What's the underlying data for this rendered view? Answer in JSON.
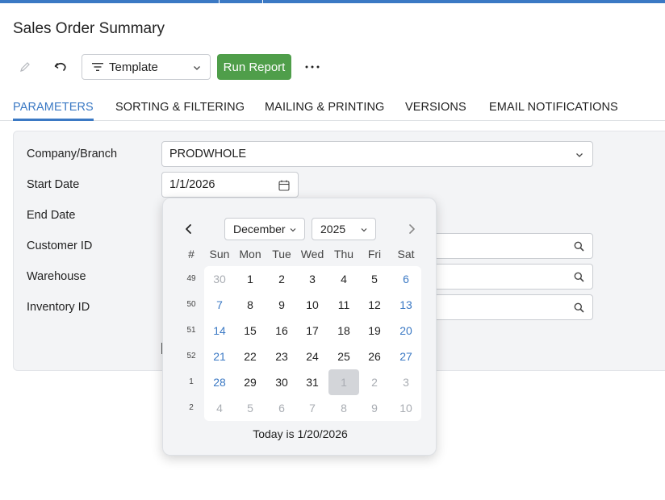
{
  "page": {
    "title": "Sales Order Summary"
  },
  "toolbar": {
    "template_label": "Template",
    "run_report_label": "Run Report",
    "more_label": "⋯"
  },
  "tabs": [
    {
      "label": "PARAMETERS",
      "active": true
    },
    {
      "label": "SORTING & FILTERING",
      "active": false
    },
    {
      "label": "MAILING & PRINTING",
      "active": false
    },
    {
      "label": "VERSIONS",
      "active": false
    },
    {
      "label": "EMAIL NOTIFICATIONS",
      "active": false
    }
  ],
  "params": {
    "company_label": "Company/Branch",
    "company_value": "PRODWHOLE",
    "start_date_label": "Start Date",
    "start_date_value": "1/1/2026",
    "end_date_label": "End Date",
    "customer_label": "Customer ID",
    "warehouse_label": "Warehouse",
    "inventory_label": "Inventory ID"
  },
  "calendar": {
    "month": "December",
    "year": "2025",
    "week_header": "#",
    "weekdays": [
      "Sun",
      "Mon",
      "Tue",
      "Wed",
      "Thu",
      "Fri",
      "Sat"
    ],
    "weeks": [
      {
        "num": "49",
        "days": [
          {
            "d": "30",
            "state": "other"
          },
          {
            "d": "1",
            "state": "normal"
          },
          {
            "d": "2",
            "state": "normal"
          },
          {
            "d": "3",
            "state": "normal"
          },
          {
            "d": "4",
            "state": "normal"
          },
          {
            "d": "5",
            "state": "normal"
          },
          {
            "d": "6",
            "state": "weekend"
          }
        ]
      },
      {
        "num": "50",
        "days": [
          {
            "d": "7",
            "state": "weekend"
          },
          {
            "d": "8",
            "state": "normal"
          },
          {
            "d": "9",
            "state": "normal"
          },
          {
            "d": "10",
            "state": "normal"
          },
          {
            "d": "11",
            "state": "normal"
          },
          {
            "d": "12",
            "state": "normal"
          },
          {
            "d": "13",
            "state": "weekend"
          }
        ]
      },
      {
        "num": "51",
        "days": [
          {
            "d": "14",
            "state": "weekend"
          },
          {
            "d": "15",
            "state": "normal"
          },
          {
            "d": "16",
            "state": "normal"
          },
          {
            "d": "17",
            "state": "normal"
          },
          {
            "d": "18",
            "state": "normal"
          },
          {
            "d": "19",
            "state": "normal"
          },
          {
            "d": "20",
            "state": "weekend"
          }
        ]
      },
      {
        "num": "52",
        "days": [
          {
            "d": "21",
            "state": "weekend"
          },
          {
            "d": "22",
            "state": "normal"
          },
          {
            "d": "23",
            "state": "normal"
          },
          {
            "d": "24",
            "state": "normal"
          },
          {
            "d": "25",
            "state": "normal"
          },
          {
            "d": "26",
            "state": "normal"
          },
          {
            "d": "27",
            "state": "weekend"
          }
        ]
      },
      {
        "num": "1",
        "days": [
          {
            "d": "28",
            "state": "weekend"
          },
          {
            "d": "29",
            "state": "normal"
          },
          {
            "d": "30",
            "state": "normal"
          },
          {
            "d": "31",
            "state": "normal"
          },
          {
            "d": "1",
            "state": "selected"
          },
          {
            "d": "2",
            "state": "other"
          },
          {
            "d": "3",
            "state": "other"
          }
        ]
      },
      {
        "num": "2",
        "days": [
          {
            "d": "4",
            "state": "other"
          },
          {
            "d": "5",
            "state": "other"
          },
          {
            "d": "6",
            "state": "other"
          },
          {
            "d": "7",
            "state": "other"
          },
          {
            "d": "8",
            "state": "other"
          },
          {
            "d": "9",
            "state": "other"
          },
          {
            "d": "10",
            "state": "other"
          }
        ]
      }
    ],
    "today_text": "Today is 1/20/2026"
  },
  "colors": {
    "accent": "#3b79c4",
    "run_button": "#4f9e4a",
    "panel_bg": "#f3f4f6"
  }
}
